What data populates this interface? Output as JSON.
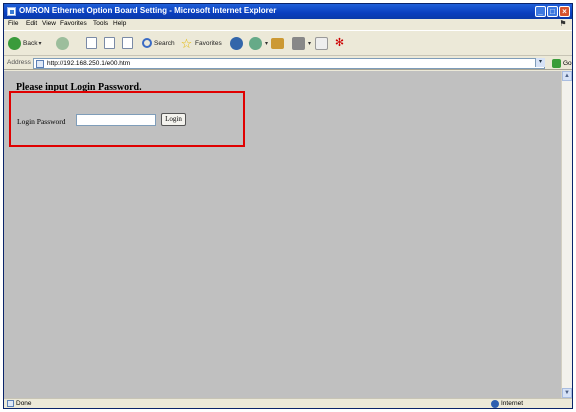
{
  "window": {
    "title": "OMRON Ethernet Option Board Setting - Microsoft Internet Explorer",
    "min_glyph": "_",
    "max_glyph": "□",
    "close_glyph": "×"
  },
  "menubar": {
    "items": [
      "File",
      "Edit",
      "View",
      "Favorites",
      "Tools",
      "Help"
    ]
  },
  "toolbar": {
    "back_label": "Back",
    "search_label": "Search",
    "favorites_label": "Favorites"
  },
  "address": {
    "label": "Address",
    "url": "http://192.168.250.1/e00.htm",
    "go_label": "Go"
  },
  "page": {
    "heading": "Please input Login Password.",
    "login_label": "Login Password",
    "password_value": "",
    "login_button": "Login",
    "highlight_color": "#e00000"
  },
  "status": {
    "text": "Done",
    "zone": "Internet"
  }
}
